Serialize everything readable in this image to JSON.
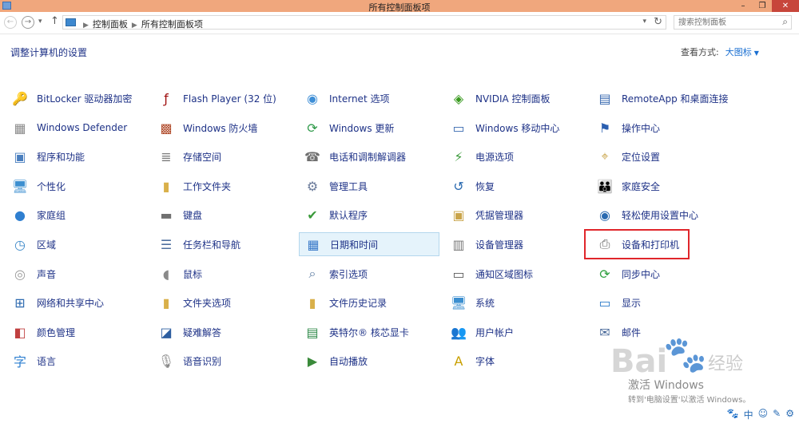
{
  "window": {
    "title": "所有控制面板项",
    "minimize": "–",
    "maximize": "❐",
    "close": "✕"
  },
  "address": {
    "crumbs": [
      "控制面板",
      "所有控制面板项"
    ],
    "search_placeholder": "搜索控制面板"
  },
  "header": {
    "title": "调整计算机的设置",
    "view_by_label": "查看方式:",
    "view_by_value": "大图标"
  },
  "items": [
    {
      "label": "BitLocker 驱动器加密",
      "icon": "key-drive-icon",
      "glyph": "🔑",
      "color": "#c9a44a"
    },
    {
      "label": "Windows Defender",
      "icon": "defender-wall-icon",
      "glyph": "▦",
      "color": "#8a8a8a"
    },
    {
      "label": "程序和功能",
      "icon": "programs-icon",
      "glyph": "▣",
      "color": "#4a7fbf"
    },
    {
      "label": "个性化",
      "icon": "personalize-icon",
      "glyph": "🖥",
      "color": "#3c8fd0"
    },
    {
      "label": "家庭组",
      "icon": "homegroup-icon",
      "glyph": "●",
      "color": "#2f7fd0"
    },
    {
      "label": "区域",
      "icon": "region-clock-icon",
      "glyph": "◷",
      "color": "#3d89c9"
    },
    {
      "label": "声音",
      "icon": "speaker-icon",
      "glyph": "◎",
      "color": "#9a9a9a"
    },
    {
      "label": "网络和共享中心",
      "icon": "network-icon",
      "glyph": "⊞",
      "color": "#2d6ab0"
    },
    {
      "label": "颜色管理",
      "icon": "color-management-icon",
      "glyph": "◧",
      "color": "#c04040"
    },
    {
      "label": "语言",
      "icon": "language-icon",
      "glyph": "字",
      "color": "#2d7fd0"
    },
    {
      "label": "Flash Player (32 位)",
      "icon": "flash-icon",
      "glyph": "ƒ",
      "color": "#a01010"
    },
    {
      "label": "Windows 防火墙",
      "icon": "firewall-icon",
      "glyph": "▩",
      "color": "#b04a2a"
    },
    {
      "label": "存储空间",
      "icon": "storage-icon",
      "glyph": "≣",
      "color": "#7a7a7a"
    },
    {
      "label": "工作文件夹",
      "icon": "work-folder-icon",
      "glyph": "▮",
      "color": "#d9b04a"
    },
    {
      "label": "键盘",
      "icon": "keyboard-icon",
      "glyph": "▬",
      "color": "#707070"
    },
    {
      "label": "任务栏和导航",
      "icon": "taskbar-icon",
      "glyph": "☰",
      "color": "#4f6f9f"
    },
    {
      "label": "鼠标",
      "icon": "mouse-icon",
      "glyph": "◖",
      "color": "#8a8a8a"
    },
    {
      "label": "文件夹选项",
      "icon": "folder-options-icon",
      "glyph": "▮",
      "color": "#d9b04a"
    },
    {
      "label": "疑难解答",
      "icon": "troubleshoot-icon",
      "glyph": "◪",
      "color": "#2d5ea0"
    },
    {
      "label": "语音识别",
      "icon": "microphone-icon",
      "glyph": "🎙",
      "color": "#8a8a8a"
    },
    {
      "label": "Internet 选项",
      "icon": "internet-options-icon",
      "glyph": "◉",
      "color": "#3e8ed6"
    },
    {
      "label": "Windows 更新",
      "icon": "windows-update-icon",
      "glyph": "⟳",
      "color": "#2f9a4a"
    },
    {
      "label": "电话和调制解调器",
      "icon": "phone-modem-icon",
      "glyph": "☎",
      "color": "#707070"
    },
    {
      "label": "管理工具",
      "icon": "admin-tools-icon",
      "glyph": "⚙",
      "color": "#6a7a9a"
    },
    {
      "label": "默认程序",
      "icon": "default-programs-icon",
      "glyph": "✔",
      "color": "#3a9a3a"
    },
    {
      "label": "日期和时间",
      "icon": "calendar-icon",
      "glyph": "▦",
      "color": "#3a7ac9"
    },
    {
      "label": "索引选项",
      "icon": "indexing-icon",
      "glyph": "⌕",
      "color": "#5a7aa0"
    },
    {
      "label": "文件历史记录",
      "icon": "file-history-icon",
      "glyph": "▮",
      "color": "#d9b04a"
    },
    {
      "label": "英特尔® 核芯显卡",
      "icon": "intel-graphics-icon",
      "glyph": "▤",
      "color": "#2f8a4a"
    },
    {
      "label": "自动播放",
      "icon": "autoplay-icon",
      "glyph": "▶",
      "color": "#3a8a3a"
    },
    {
      "label": "NVIDIA 控制面板",
      "icon": "nvidia-icon",
      "glyph": "◈",
      "color": "#3a9a20"
    },
    {
      "label": "Windows 移动中心",
      "icon": "mobility-center-icon",
      "glyph": "▭",
      "color": "#3a6ab0"
    },
    {
      "label": "电源选项",
      "icon": "power-options-icon",
      "glyph": "⚡",
      "color": "#3a9a3a"
    },
    {
      "label": "恢复",
      "icon": "recovery-icon",
      "glyph": "↺",
      "color": "#2a6ab0"
    },
    {
      "label": "凭据管理器",
      "icon": "credential-manager-icon",
      "glyph": "▣",
      "color": "#c9a44a"
    },
    {
      "label": "设备管理器",
      "icon": "device-manager-icon",
      "glyph": "▥",
      "color": "#7a7a7a"
    },
    {
      "label": "通知区域图标",
      "icon": "notification-icons-icon",
      "glyph": "▭",
      "color": "#5a5a5a"
    },
    {
      "label": "系统",
      "icon": "system-icon",
      "glyph": "🖥",
      "color": "#3c8fd0"
    },
    {
      "label": "用户帐户",
      "icon": "user-accounts-icon",
      "glyph": "👥",
      "color": "#4a7ab0"
    },
    {
      "label": "字体",
      "icon": "fonts-icon",
      "glyph": "A",
      "color": "#c9a000"
    },
    {
      "label": "RemoteApp 和桌面连接",
      "icon": "remoteapp-icon",
      "glyph": "▤",
      "color": "#3a6ab0"
    },
    {
      "label": "操作中心",
      "icon": "action-center-flag-icon",
      "glyph": "⚑",
      "color": "#2a5fb0"
    },
    {
      "label": "定位设置",
      "icon": "location-icon",
      "glyph": "⌖",
      "color": "#c9a44a"
    },
    {
      "label": "家庭安全",
      "icon": "family-safety-icon",
      "glyph": "👪",
      "color": "#3c8fd0"
    },
    {
      "label": "轻松使用设置中心",
      "icon": "ease-of-access-icon",
      "glyph": "◉",
      "color": "#2a6ab0"
    },
    {
      "label": "设备和打印机",
      "icon": "printer-icon",
      "glyph": "⎙",
      "color": "#6a6a6a"
    },
    {
      "label": "同步中心",
      "icon": "sync-center-icon",
      "glyph": "⟳",
      "color": "#2fa040"
    },
    {
      "label": "显示",
      "icon": "display-icon",
      "glyph": "▭",
      "color": "#2a7ac9"
    },
    {
      "label": "邮件",
      "icon": "mail-icon",
      "glyph": "✉",
      "color": "#4a6a9a"
    }
  ],
  "watermark": {
    "logo": "Bai",
    "brand": "经验",
    "activate_title": "激活 Windows",
    "activate_sub": "转到'电脑设置'以激活 Windows。"
  },
  "tray": [
    "🐾",
    "中",
    "☺",
    "✎",
    "⚙"
  ]
}
